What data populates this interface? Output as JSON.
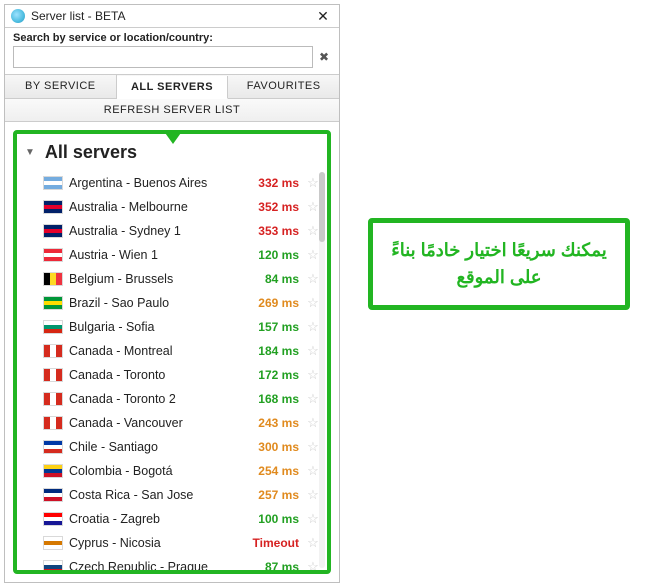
{
  "window": {
    "title": "Server list - BETA",
    "close_glyph": "✕"
  },
  "search": {
    "label": "Search by service or location/country:",
    "value": "",
    "clear_glyph": "✖"
  },
  "tabs": {
    "by_service": "BY SERVICE",
    "all_servers": "ALL SERVERS",
    "favourites": "FAVOURITES"
  },
  "refresh_label": "REFRESH SERVER LIST",
  "list": {
    "caret": "▼",
    "title": "All servers",
    "star_glyph": "☆"
  },
  "servers": [
    {
      "name": "Argentina - Buenos Aires",
      "ping": "332 ms",
      "cls": "red",
      "flag": [
        "#74ACDF",
        "#FFFFFF",
        "#74ACDF"
      ]
    },
    {
      "name": "Australia - Melbourne",
      "ping": "352 ms",
      "cls": "red",
      "flag": [
        "#012169",
        "#E4002B",
        "#012169"
      ]
    },
    {
      "name": "Australia - Sydney 1",
      "ping": "353 ms",
      "cls": "red",
      "flag": [
        "#012169",
        "#E4002B",
        "#012169"
      ]
    },
    {
      "name": "Austria - Wien 1",
      "ping": "120 ms",
      "cls": "green",
      "flag": [
        "#ED2939",
        "#FFFFFF",
        "#ED2939"
      ]
    },
    {
      "name": "Belgium - Brussels",
      "ping": "84 ms",
      "cls": "green",
      "flag": [
        "#000000",
        "#FDDA24",
        "#EF3340"
      ],
      "vertical": true
    },
    {
      "name": "Brazil - Sao Paulo",
      "ping": "269 ms",
      "cls": "orange",
      "flag": [
        "#009739",
        "#FEDD00",
        "#009739"
      ]
    },
    {
      "name": "Bulgaria - Sofia",
      "ping": "157 ms",
      "cls": "green",
      "flag": [
        "#FFFFFF",
        "#00966E",
        "#D62612"
      ]
    },
    {
      "name": "Canada - Montreal",
      "ping": "184 ms",
      "cls": "green",
      "flag": [
        "#D52B1E",
        "#FFFFFF",
        "#D52B1E"
      ],
      "vertical": true
    },
    {
      "name": "Canada - Toronto",
      "ping": "172 ms",
      "cls": "green",
      "flag": [
        "#D52B1E",
        "#FFFFFF",
        "#D52B1E"
      ],
      "vertical": true
    },
    {
      "name": "Canada - Toronto 2",
      "ping": "168 ms",
      "cls": "green",
      "flag": [
        "#D52B1E",
        "#FFFFFF",
        "#D52B1E"
      ],
      "vertical": true
    },
    {
      "name": "Canada - Vancouver",
      "ping": "243 ms",
      "cls": "orange",
      "flag": [
        "#D52B1E",
        "#FFFFFF",
        "#D52B1E"
      ],
      "vertical": true
    },
    {
      "name": "Chile - Santiago",
      "ping": "300 ms",
      "cls": "orange",
      "flag": [
        "#0039A6",
        "#FFFFFF",
        "#D52B1E"
      ]
    },
    {
      "name": "Colombia - Bogotá",
      "ping": "254 ms",
      "cls": "orange",
      "flag": [
        "#FCD116",
        "#003893",
        "#CE1126"
      ]
    },
    {
      "name": "Costa Rica - San Jose",
      "ping": "257 ms",
      "cls": "orange",
      "flag": [
        "#002B7F",
        "#FFFFFF",
        "#CE1126"
      ]
    },
    {
      "name": "Croatia - Zagreb",
      "ping": "100 ms",
      "cls": "green",
      "flag": [
        "#FF0000",
        "#FFFFFF",
        "#171796"
      ]
    },
    {
      "name": "Cyprus - Nicosia",
      "ping": "Timeout",
      "cls": "red",
      "flag": [
        "#FFFFFF",
        "#D57800",
        "#FFFFFF"
      ]
    },
    {
      "name": "Czech Republic - Prague",
      "ping": "87 ms",
      "cls": "green",
      "flag": [
        "#FFFFFF",
        "#11457E",
        "#D7141A"
      ]
    }
  ],
  "callout": {
    "text": "يمكنك سريعًا اختيار خادمًا بناءً على الموقع"
  }
}
